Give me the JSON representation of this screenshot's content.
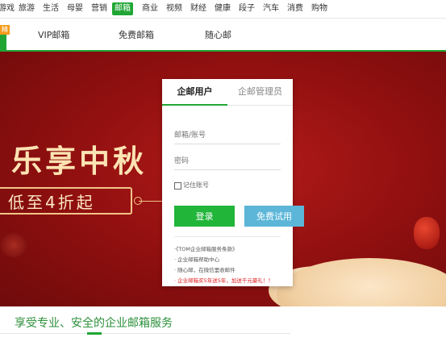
{
  "topnav": {
    "items": [
      "游戏",
      "旅游",
      "生活",
      "母婴",
      "营销",
      "邮箱",
      "商业",
      "视频",
      "财经",
      "健康",
      "段子",
      "汽车",
      "消费",
      "购物"
    ],
    "active_index": 5
  },
  "subbar": {
    "badge": "精",
    "links": [
      "VIP邮箱",
      "免费邮箱",
      "随心邮"
    ]
  },
  "banner": {
    "title": "乐享中秋",
    "subtitle": "低至4折起"
  },
  "login": {
    "tab_user": "企邮用户",
    "tab_admin": "企邮管理员",
    "account_placeholder": "邮箱/账号",
    "password_placeholder": "密码",
    "remember_label": "记住账号",
    "login_button": "登录",
    "trial_button": "免费试用",
    "notes": [
      "·《TOM企业邮箱服务条款》",
      "· 企业邮箱帮助中心",
      "· 随心邮，在微信里收邮件",
      "· 企业邮箱买5年送5年，加送千元豪礼！！"
    ]
  },
  "bottom": {
    "slogan": "享受专业、安全的企业邮箱服务"
  },
  "colors": {
    "brand_green": "#21a635",
    "banner_red": "#8e0f0f",
    "trial_blue": "#5bb6d8"
  }
}
